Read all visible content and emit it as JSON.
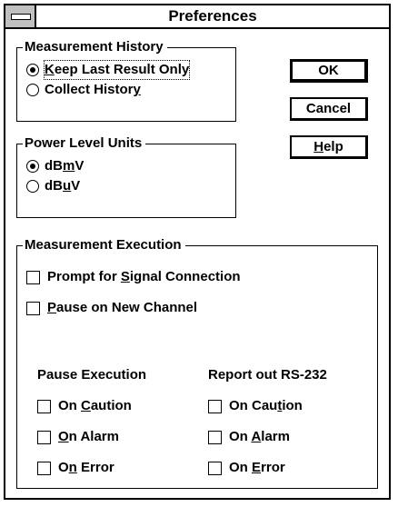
{
  "window": {
    "title": "Preferences"
  },
  "measurement_history": {
    "label": "Measurement History",
    "options": [
      {
        "pre": "",
        "u": "K",
        "post": "eep Last Result Only",
        "selected": true
      },
      {
        "pre": "Collect Histor",
        "u": "y",
        "post": "",
        "selected": false
      }
    ]
  },
  "power_units": {
    "label": "Power Level Units",
    "options": [
      {
        "pre": "dB",
        "u": "m",
        "post": "V",
        "selected": true
      },
      {
        "pre": "dB",
        "u": "u",
        "post": "V",
        "selected": false
      }
    ]
  },
  "buttons": {
    "ok": "OK",
    "cancel": "Cancel",
    "help": {
      "pre": "",
      "u": "H",
      "post": "elp"
    }
  },
  "execution": {
    "label": "Measurement Execution",
    "prompt": {
      "pre": "Prompt for ",
      "u": "S",
      "post": "ignal Connection",
      "checked": false
    },
    "pause_channel": {
      "pre": "",
      "u": "P",
      "post": "ause on New Channel",
      "checked": false
    },
    "pause_col": {
      "header": "Pause Execution",
      "items": [
        {
          "pre": "On ",
          "u": "C",
          "post": "aution",
          "checked": false
        },
        {
          "pre": "",
          "u": "O",
          "post": "n Alarm",
          "checked": false
        },
        {
          "pre": "O",
          "u": "n",
          "post": " Error",
          "checked": false
        }
      ]
    },
    "report_col": {
      "header": "Report out RS-232",
      "items": [
        {
          "pre": "On Cau",
          "u": "t",
          "post": "ion",
          "checked": false
        },
        {
          "pre": "On ",
          "u": "A",
          "post": "larm",
          "checked": false
        },
        {
          "pre": "On ",
          "u": "E",
          "post": "rror",
          "checked": false
        }
      ]
    }
  }
}
